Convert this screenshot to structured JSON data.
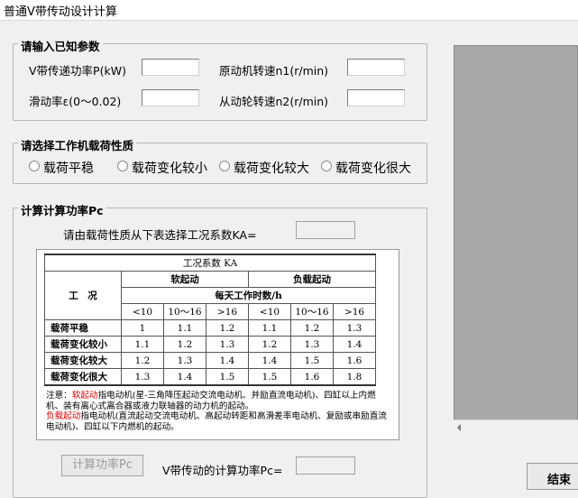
{
  "window": {
    "title": "普通V带传动设计计算"
  },
  "known_params": {
    "legend": "请输入已知参数",
    "power_label": "V带传递功率P(kW)",
    "power_value": "",
    "motor_speed_label": "原动机转速n1(r/min)",
    "motor_speed_value": "",
    "slip_label": "滑动率ε(0～0.02)",
    "slip_value": "",
    "driven_speed_label": "从动轮转速n2(r/min)",
    "driven_speed_value": ""
  },
  "load_type": {
    "legend": "请选择工作机载荷性质",
    "options": [
      "载荷平稳",
      "载荷变化较小",
      "载荷变化较大",
      "载荷变化很大"
    ]
  },
  "calc_power": {
    "legend": "计算计算功率Pc",
    "ka_prompt": "请由载荷性质从下表选择工况系数KA=",
    "ka_value": "",
    "button_label": "计算功率Pc",
    "pc_label": "V带传动的计算功率Pc=",
    "pc_value": ""
  },
  "ka_table": {
    "title": "工况系数 KA",
    "soft_start": "软起动",
    "load_start": "负载起动",
    "condition": "工　况",
    "hours_header": "每天工作时数/h",
    "hour_cols": [
      "<10",
      "10～16",
      ">16",
      "<10",
      "10～16",
      ">16"
    ],
    "rows": [
      {
        "name": "载荷平稳",
        "values": [
          "1",
          "1.1",
          "1.2",
          "1.1",
          "1.2",
          "1.3"
        ]
      },
      {
        "name": "载荷变化较小",
        "values": [
          "1.1",
          "1.2",
          "1.3",
          "1.2",
          "1.3",
          "1.4"
        ]
      },
      {
        "name": "载荷变化较大",
        "values": [
          "1.2",
          "1.3",
          "1.4",
          "1.4",
          "1.5",
          "1.6"
        ]
      },
      {
        "name": "载荷变化很大",
        "values": [
          "1.3",
          "1.4",
          "1.5",
          "1.5",
          "1.6",
          "1.8"
        ]
      }
    ],
    "note_prefix": "注意：",
    "note_soft_term": "软起动",
    "note_soft_text": "指电动机(星-三角降压起动交流电动机、并励直流电动机)、四缸以上内燃机、装有离心式离合器或液力联轴器的动力机的起动。",
    "note_load_term": "负载起动",
    "note_load_text": "指电动机(直流起动交流电动机、高起动转距和高滑差率电动机、复励或串励直流电动机)、四缸以下内燃机的起动。"
  },
  "footer": {
    "end_button": "结束"
  }
}
